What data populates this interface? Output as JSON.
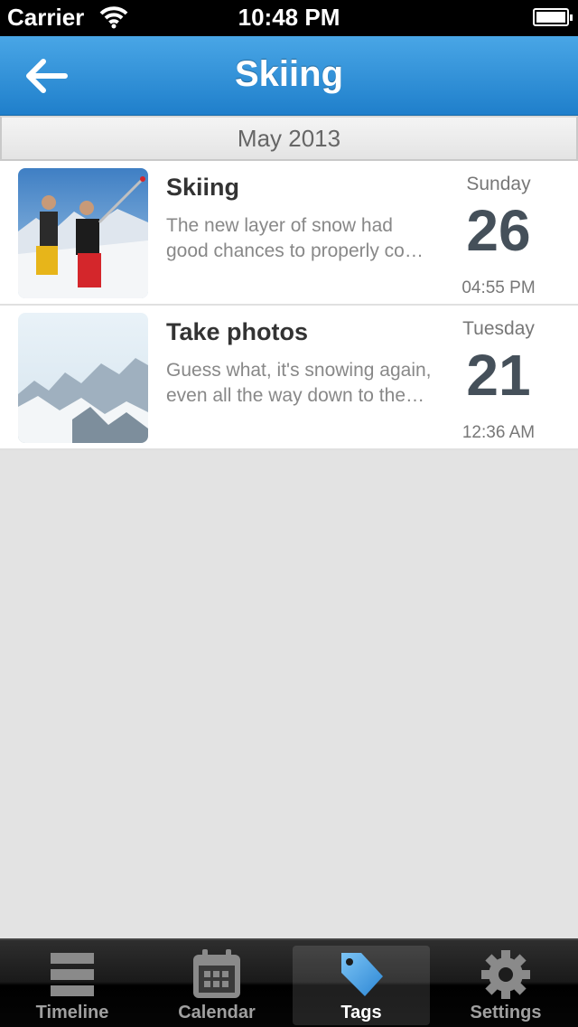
{
  "status_bar": {
    "carrier": "Carrier",
    "time": "10:48 PM"
  },
  "nav": {
    "title": "Skiing"
  },
  "section": {
    "title": "May 2013"
  },
  "entries": [
    {
      "title": "Skiing",
      "excerpt_line1": "The new layer of snow had",
      "excerpt_line2": "good chances to properly co…",
      "day": "Sunday",
      "date": "26",
      "time": "04:55 PM",
      "thumbnail": "two skiers on snowy peak"
    },
    {
      "title": "Take photos",
      "excerpt_line1": "Guess what, it's snowing again,",
      "excerpt_line2": "even all the way down to the…",
      "day": "Tuesday",
      "date": "21",
      "time": "12:36 AM",
      "thumbnail": "snowy mountain landscape"
    }
  ],
  "tabs": [
    {
      "label": "Timeline",
      "icon": "timeline-icon"
    },
    {
      "label": "Calendar",
      "icon": "calendar-icon"
    },
    {
      "label": "Tags",
      "icon": "tag-icon",
      "active": true
    },
    {
      "label": "Settings",
      "icon": "gear-icon"
    }
  ],
  "colors": {
    "nav_blue": "#2b8ad6",
    "date_text": "#45505a",
    "tab_active_icon": "#5aa8ec"
  }
}
